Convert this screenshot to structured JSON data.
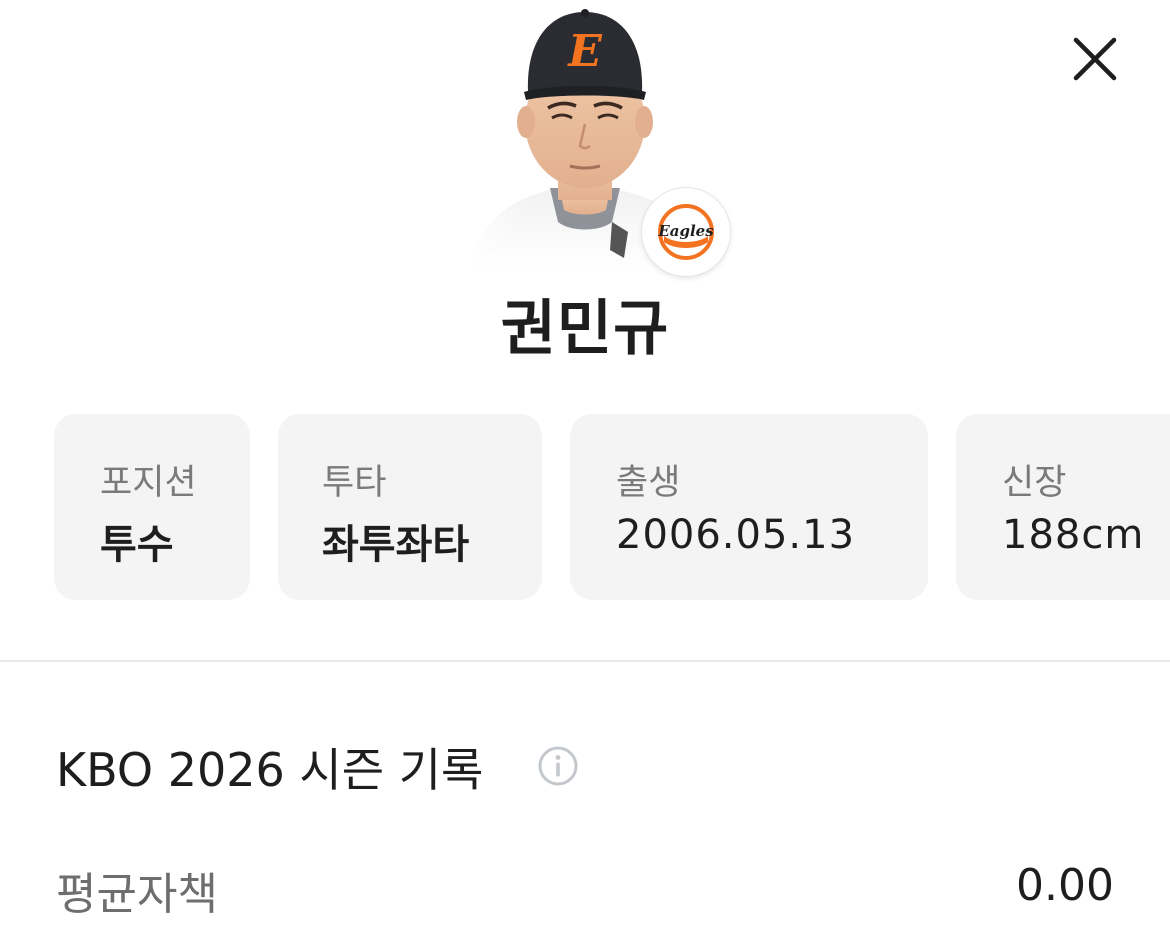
{
  "player": {
    "name": "권민규",
    "team_logo_text": "Eagles",
    "cap_letter": "E"
  },
  "info_cards": [
    {
      "label": "포지션",
      "value": "투수"
    },
    {
      "label": "투타",
      "value": "좌투좌타"
    },
    {
      "label": "출생",
      "value": "2006.05.13"
    },
    {
      "label": "신장",
      "value": "188cm"
    }
  ],
  "season": {
    "title": "KBO 2026 시즌 기록",
    "stats": [
      {
        "label": "평균자책",
        "value": "0.00"
      }
    ]
  },
  "colors": {
    "brand_orange": "#F37321",
    "card_bg": "#F4F4F4",
    "text_primary": "#1E1E1E",
    "text_secondary": "#7A7A7A"
  },
  "icons": {
    "close": "close-icon",
    "info": "info-circle-icon"
  }
}
